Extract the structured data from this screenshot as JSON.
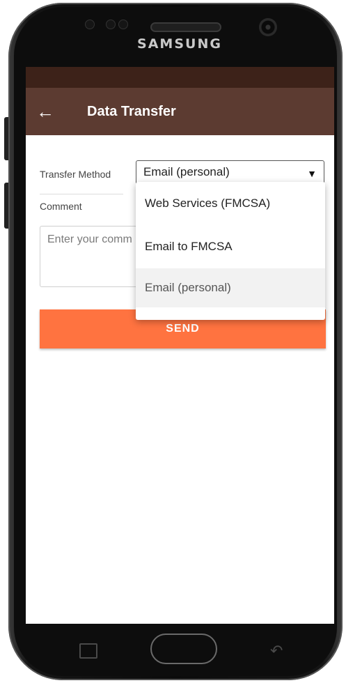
{
  "device": {
    "brand": "SAMSUNG"
  },
  "app_bar": {
    "title": "Data Transfer"
  },
  "form": {
    "transfer_method_label": "Transfer Method",
    "transfer_method_value": "Email (personal)",
    "comment_label": "Comment",
    "comment_placeholder": "Enter your comm"
  },
  "dropdown": {
    "options": [
      "Web Services (FMCSA)",
      "Email to FMCSA",
      "Email (personal)"
    ],
    "selected": "Email (personal)"
  },
  "send_button": {
    "label": "SEND"
  },
  "colors": {
    "status_bar": "#3d2219",
    "app_bar": "#5c3b31",
    "accent": "#ff7340",
    "selected_option_bg": "#f2f2f2"
  },
  "icons": {
    "back": "arrow-left-icon",
    "caret": "caret-down-icon",
    "nav_recent": "recent-apps-icon",
    "nav_back": "nav-back-icon"
  }
}
